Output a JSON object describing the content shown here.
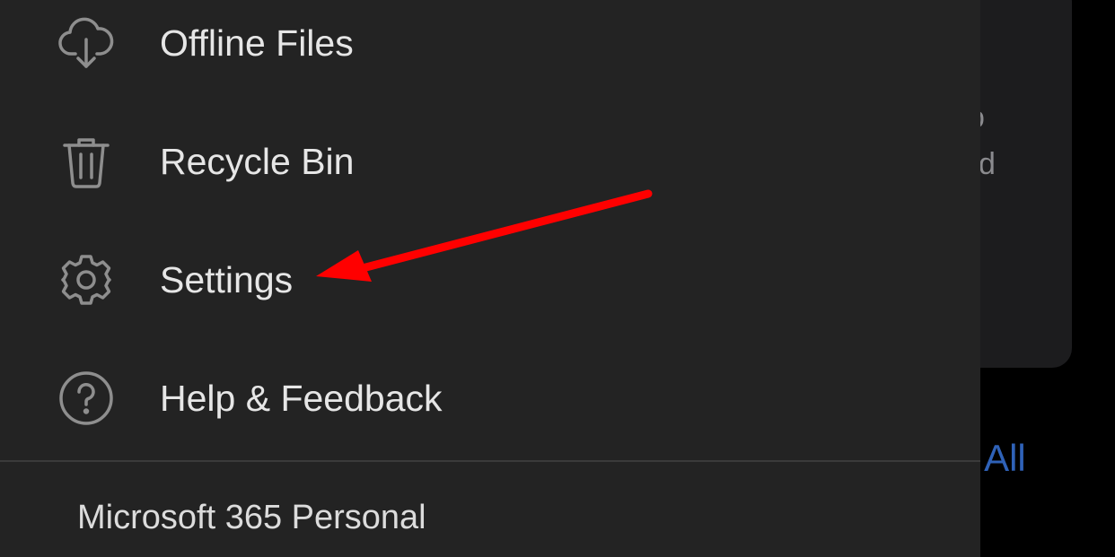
{
  "background": {
    "partial_text_1": "o",
    "partial_text_2": "d",
    "see_all_label": "ee All"
  },
  "drawer": {
    "items": [
      {
        "label": "Offline Files",
        "icon": "cloud-download-icon"
      },
      {
        "label": "Recycle Bin",
        "icon": "trash-icon"
      },
      {
        "label": "Settings",
        "icon": "gear-icon"
      },
      {
        "label": "Help & Feedback",
        "icon": "help-circle-icon"
      }
    ],
    "subscription": "Microsoft 365 Personal"
  },
  "colors": {
    "drawer_bg": "#232323",
    "icon": "#8e8e8e",
    "annotation_arrow": "#ff0000",
    "link": "#2f62b8"
  }
}
